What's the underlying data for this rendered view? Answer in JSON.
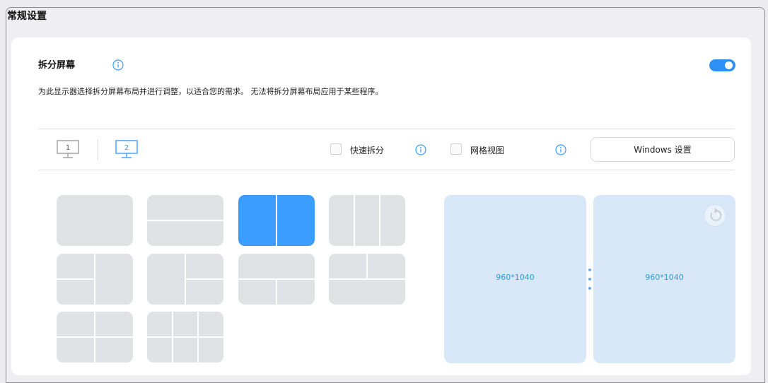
{
  "window": {
    "title": "常规设置"
  },
  "section": {
    "title": "拆分屏幕",
    "description": "为此显示器选择拆分屏幕布局并进行调整，以适合您的需求。 无法将拆分屏幕布局应用于某些程序。",
    "enabled": true
  },
  "monitors": [
    {
      "label": "1",
      "selected": false
    },
    {
      "label": "2",
      "selected": true
    }
  ],
  "options": {
    "quick_split": {
      "label": "快速拆分",
      "checked": false
    },
    "grid_view": {
      "label": "网格视图",
      "checked": false
    },
    "windows_settings_label": "Windows 设置"
  },
  "layouts": [
    {
      "id": "full",
      "selected": false
    },
    {
      "id": "top-bottom",
      "selected": false
    },
    {
      "id": "left-right",
      "selected": true
    },
    {
      "id": "three-columns",
      "selected": false
    },
    {
      "id": "left-half-right-top-bottom",
      "selected": false
    },
    {
      "id": "left-right-split-rows",
      "selected": false
    },
    {
      "id": "top-full-bottom-two",
      "selected": false
    },
    {
      "id": "top-two-bottom-full",
      "selected": false
    },
    {
      "id": "four-quadrants",
      "selected": false
    },
    {
      "id": "six-grid",
      "selected": false
    }
  ],
  "preview": {
    "screens": [
      {
        "resolution": "960*1040"
      },
      {
        "resolution": "960*1040"
      }
    ]
  },
  "colors": {
    "accent": "#3a9dff",
    "toggle": "#2e8ff5",
    "screen_bg": "#d9e8f8",
    "resolution_text": "#2a9bd8"
  }
}
